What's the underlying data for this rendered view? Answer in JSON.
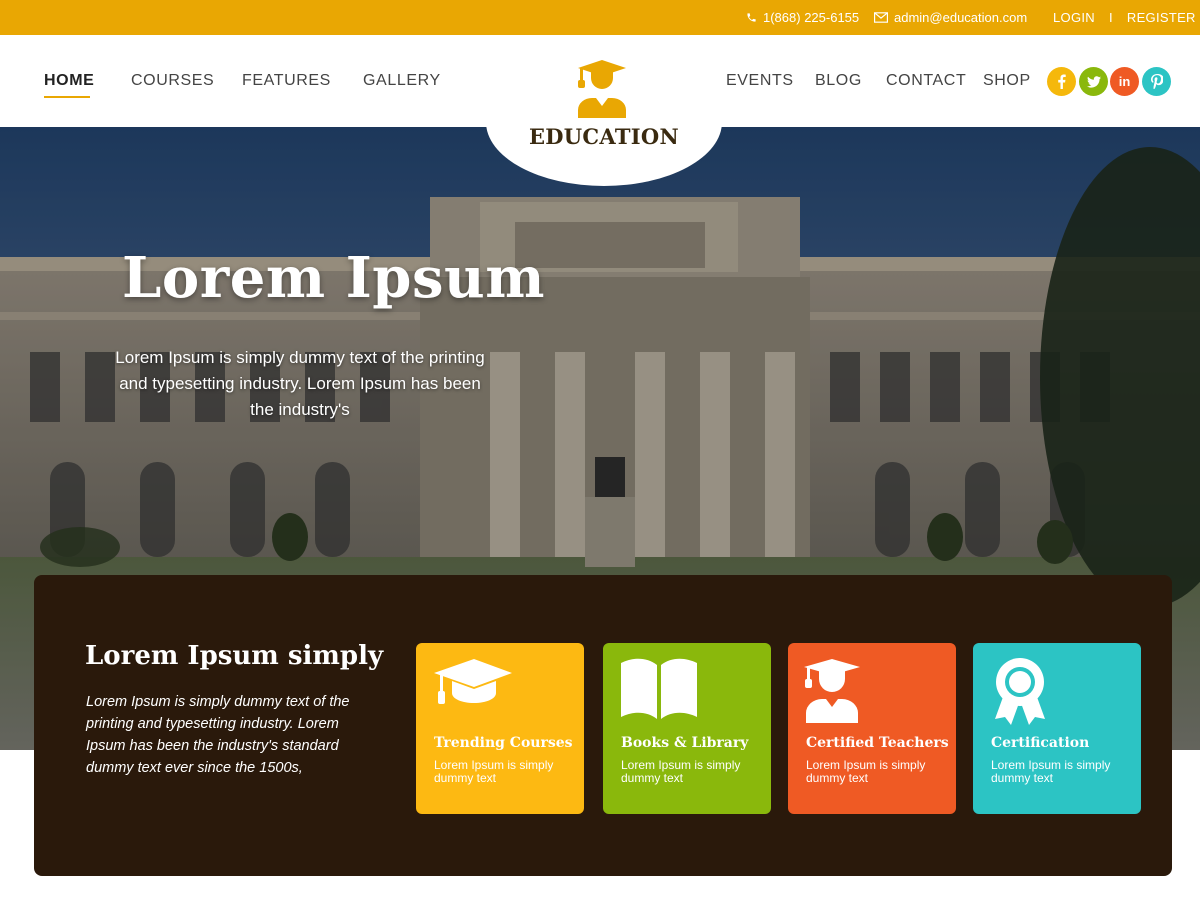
{
  "topbar": {
    "phone": "1(868) 225-6155",
    "email": "admin@education.com",
    "login": "LOGIN",
    "separator": "I",
    "register": "REGISTER",
    "bg_color": "#e9a703"
  },
  "nav": {
    "left": [
      "HOME",
      "COURSES",
      "FEATURES",
      "GALLERY"
    ],
    "right": [
      "EVENTS",
      "BLOG",
      "CONTACT",
      "SHOP"
    ],
    "active": "HOME"
  },
  "logo": {
    "text": "EDUCATION",
    "icon": "graduate-icon"
  },
  "social": [
    {
      "name": "facebook-icon",
      "glyph": "f",
      "color": "#f5b80c"
    },
    {
      "name": "twitter-icon",
      "glyph": "t",
      "color": "#8ab80c"
    },
    {
      "name": "linkedin-icon",
      "glyph": "in",
      "color": "#ef5a24"
    },
    {
      "name": "pinterest-icon",
      "glyph": "p",
      "color": "#2cc4c4"
    }
  ],
  "hero": {
    "title": "Lorem Ipsum",
    "subtitle": "Lorem Ipsum is simply dummy text of the printing and typesetting industry. Lorem Ipsum has been the industry's"
  },
  "panel": {
    "title": "Lorem Ipsum simply",
    "text": "Lorem Ipsum is simply dummy text of the printing and typesetting industry. Lorem Ipsum has been the industry's standard dummy text ever since the 1500s,",
    "bg_color": "#2a190b"
  },
  "cards": [
    {
      "title": "Trending Courses",
      "desc": "Lorem Ipsum is simply dummy text",
      "color": "#fdb912",
      "icon": "graduation-cap-icon"
    },
    {
      "title": "Books & Library",
      "desc": "Lorem Ipsum is simply dummy text",
      "color": "#8ab80c",
      "icon": "book-icon"
    },
    {
      "title": "Certified Teachers",
      "desc": "Lorem Ipsum is simply dummy text",
      "color": "#ef5a24",
      "icon": "teacher-icon"
    },
    {
      "title": "Certification",
      "desc": "Lorem Ipsum is simply dummy text",
      "color": "#2cc4c4",
      "icon": "award-ribbon-icon"
    }
  ]
}
